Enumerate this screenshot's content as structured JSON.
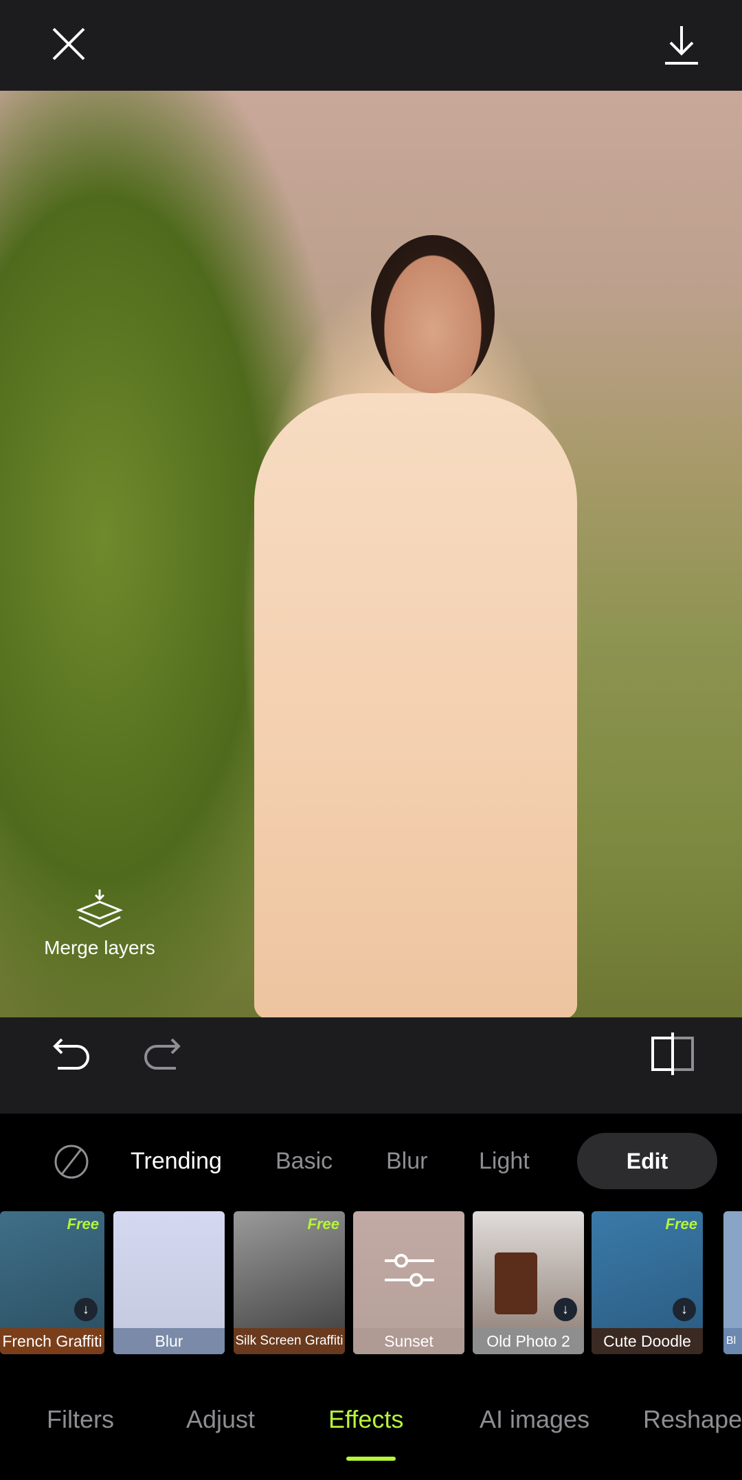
{
  "header": {
    "close_icon": "close-icon",
    "download_icon": "download-icon"
  },
  "canvas": {
    "merge_layers_label": "Merge layers"
  },
  "toolbar": {
    "undo_icon": "undo-icon",
    "redo_icon": "redo-icon",
    "compare_icon": "compare-icon"
  },
  "categories": {
    "none_icon": "no-effect-icon",
    "items": [
      {
        "label": "Trending",
        "active": true
      },
      {
        "label": "Basic"
      },
      {
        "label": "Blur"
      },
      {
        "label": "Light"
      }
    ],
    "edit_label": "Edit"
  },
  "effects": [
    {
      "label": "French Graffiti",
      "badge": "Free",
      "download": true,
      "label_color": "#7a3f1a"
    },
    {
      "label": "Blur",
      "label_color": "#7a8aa8"
    },
    {
      "label": "Silk Screen Graffiti",
      "badge": "Free",
      "label_color": "#6a3a1e"
    },
    {
      "label": "Sunset",
      "label_color": "#b09a94"
    },
    {
      "label": "Old Photo 2",
      "download": true,
      "label_color": "#8e8e8e"
    },
    {
      "label": "Cute Doodle",
      "badge": "Free",
      "download": true,
      "label_color": "#3a2a22"
    },
    {
      "label": "Bl",
      "label_color": "#6a88b0"
    }
  ],
  "bottom_tabs": [
    {
      "label": "Filters"
    },
    {
      "label": "Adjust"
    },
    {
      "label": "Effects",
      "active": true
    },
    {
      "label": "AI images"
    },
    {
      "label": "Reshape"
    }
  ],
  "colors": {
    "accent": "#b6f53a",
    "bar": "#1c1c1e"
  }
}
